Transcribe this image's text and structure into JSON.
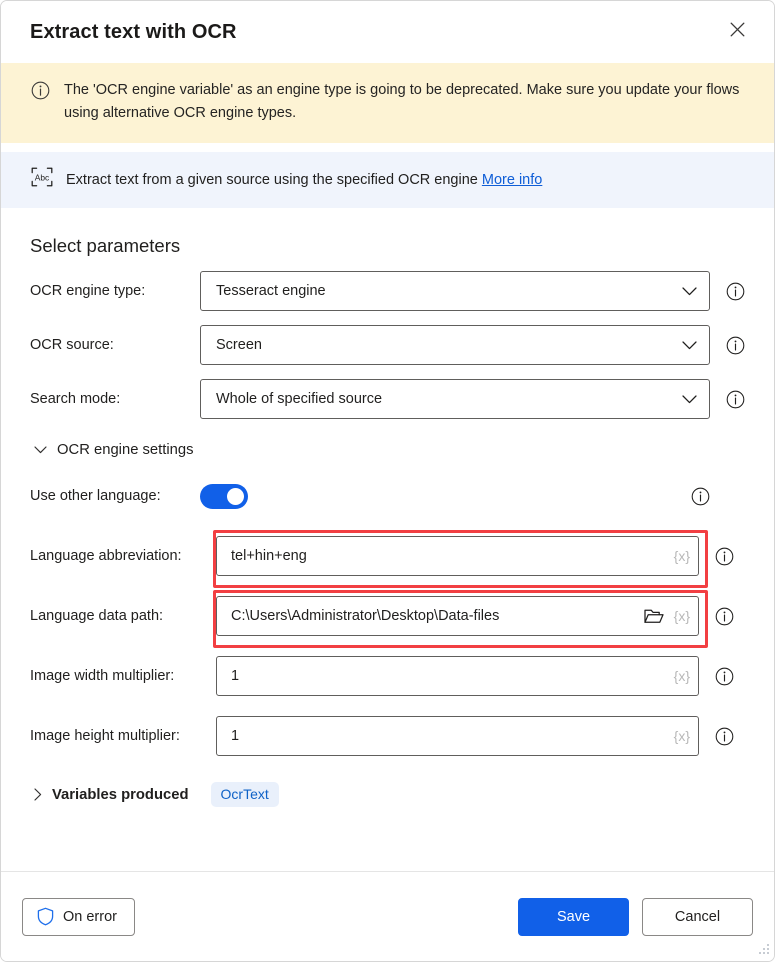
{
  "dialog": {
    "title": "Extract text with OCR",
    "close_label": "Close"
  },
  "warning": {
    "icon": "info-circle-icon",
    "text": "The 'OCR engine variable' as an engine type is going to be deprecated.  Make sure you update your flows using alternative OCR engine types."
  },
  "info": {
    "icon": "extract-text-abc-icon",
    "text": "Extract text from a given source using the specified OCR engine",
    "link_label": "More info"
  },
  "main": {
    "section_title": "Select parameters",
    "fields": [
      {
        "label": "OCR engine type:",
        "value": "Tesseract engine",
        "type": "select"
      },
      {
        "label": "OCR source:",
        "value": "Screen",
        "type": "select"
      },
      {
        "label": "Search mode:",
        "value": "Whole of specified source",
        "type": "select"
      }
    ],
    "engine_settings": {
      "header": "OCR engine settings",
      "expanded": true,
      "toggle_field": {
        "label": "Use other language:",
        "state": "on",
        "accent": "#1160e8"
      },
      "fields": [
        {
          "label": "Language abbreviation:",
          "value": "tel+hin+eng",
          "var_icon": "{x}",
          "highlighted": true,
          "highlight_color": "#f23f42"
        },
        {
          "label": "Language data path:",
          "value": "C:\\Users\\Administrator\\Desktop\\Data-files",
          "var_icon": "{x}",
          "folder_icon": "folder-open-icon",
          "highlighted": true,
          "highlight_color": "#f23f42"
        },
        {
          "label": "Image width multiplier:",
          "value": "1",
          "var_icon": "{x}",
          "highlighted": false
        },
        {
          "label": "Image height multiplier:",
          "value": "1",
          "var_icon": "{x}",
          "highlighted": false
        }
      ]
    },
    "variables_produced": {
      "header": "Variables produced",
      "expanded": false,
      "chip": "OcrText"
    }
  },
  "footer": {
    "on_error_label": "On error",
    "on_error_icon": "shield-icon",
    "save_label": "Save",
    "cancel_label": "Cancel"
  }
}
